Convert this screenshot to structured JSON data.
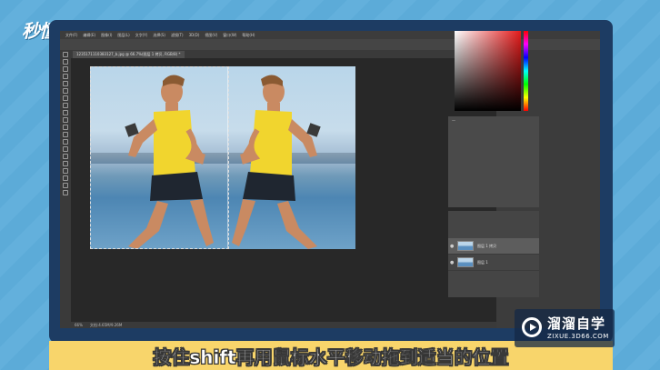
{
  "brand": {
    "logo_text": "秒懂视频"
  },
  "photoshop": {
    "menu_items": [
      "文件(F)",
      "编辑(E)",
      "图像(I)",
      "图层(L)",
      "文字(Y)",
      "选择(S)",
      "滤镜(T)",
      "3D(D)",
      "视图(V)",
      "窗口(W)",
      "帮助(H)"
    ],
    "document_tab": "1235171110383127_b.jpg @ 66.7%(图层 1 拷贝, RGB/8) *",
    "status_zoom": "66%",
    "status_doc": "文档:4.65M/9.26M",
    "layers": [
      {
        "name": "图层 1 拷贝",
        "active": true
      },
      {
        "name": "图层 1",
        "active": false
      }
    ]
  },
  "caption": "按住shift再用鼠标水平移动拖到适当的位置",
  "watermark": {
    "title": "溜溜自学",
    "subtitle": "ZIXUE.3D66.COM"
  }
}
